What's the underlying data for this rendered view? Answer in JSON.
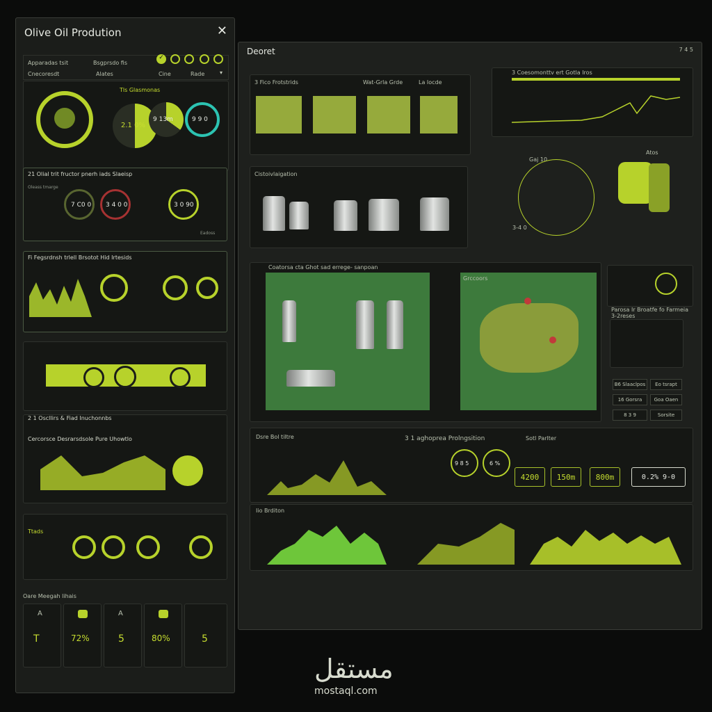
{
  "left": {
    "title": "Olive Oil Prodution",
    "tabs": [
      "Apparadas tsit",
      "Bsgprsdo fis",
      "Cnecoresdt",
      "Alates",
      "Cine",
      "Rade"
    ],
    "top": {
      "ring_label": "Tls Glasmonas",
      "gauge1": "2.1 0%",
      "gauge2": "9 13m",
      "gauge3": "9 9 0"
    },
    "sec2": {
      "title": "21 Olial trit fructor pnerh iads Slaeisp",
      "a": "Oleass tmarge",
      "b": "7 C0 0",
      "c": "3 4 0 0",
      "d": "3 0 90",
      "e": "Eadoss"
    },
    "sec3": {
      "title": "Fi Fegsrdnsh trlell Brsotot Hid Irtesids"
    },
    "sec5": {
      "title": "2 1 Oscllirs & Fiad Inuchonnbs",
      "chart_title": "Cercorsce Desrarsdsole Pure Uhowtlo"
    },
    "sec6": {
      "title": "Ttads"
    },
    "bottom": {
      "title": "Oare Meegah lihais",
      "tiles": [
        {
          "icon": "A",
          "value": "T"
        },
        {
          "icon": "",
          "value": "72%"
        },
        {
          "icon": "A",
          "value": "5"
        },
        {
          "icon": "",
          "value": "80%"
        },
        {
          "icon": "",
          "value": "5"
        }
      ]
    }
  },
  "main": {
    "title": "Deoret",
    "top_right": "7 4 5",
    "process": {
      "title": "3 Fico Frotstrids",
      "mid": "Wat-Grla Grde",
      "right": "La Iocde"
    },
    "plant": {
      "title": "Cistoivlaigation"
    },
    "chart1": {
      "title": "3 Coesomonttv ert Gotla Iros"
    },
    "machine": {
      "a": "Gaj 10",
      "b": "Atos",
      "c": "3-4 0"
    },
    "diagram": {
      "title": "Coatorsa cta Ghot sad errege- sanpoan"
    },
    "map": {
      "title": "Grccoors"
    },
    "controls": {
      "title": "Parosa Ir Broatfe fo Farmeia 3-2reses",
      "buttons": [
        "B6 Slaaclpos",
        "Eo tsrapt",
        "16 Gorsra",
        "Goa Oaen",
        "8 3 9",
        "Sorsite"
      ]
    },
    "metrics": {
      "a_title": "Dsre Bol tiltre",
      "b_title": "3 1 aghoprea Prolngsition",
      "c_title": "Sotl Parlter",
      "b_vals": [
        "9 8 5",
        "6 %"
      ],
      "boxes": [
        "4200",
        "150m",
        "800m",
        "0.2% 9-0"
      ]
    },
    "bottom": {
      "title": "Iio Brditon"
    }
  },
  "watermark": {
    "arabic": "مستقل",
    "site": "mostaql.com"
  }
}
